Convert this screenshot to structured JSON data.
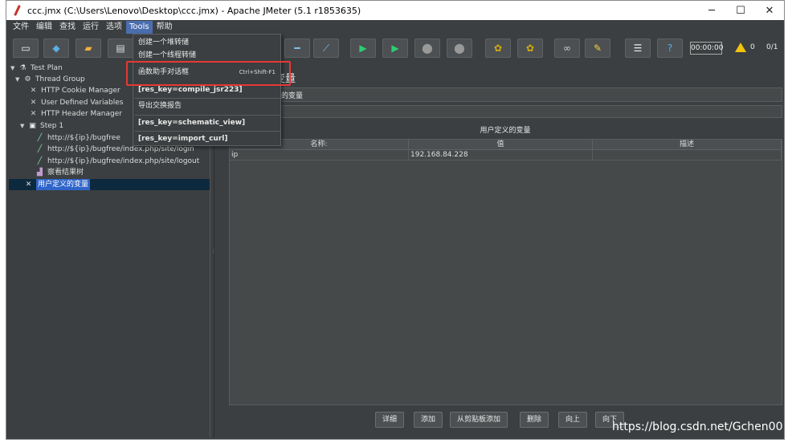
{
  "window": {
    "title": "ccc.jmx (C:\\Users\\Lenovo\\Desktop\\ccc.jmx) - Apache JMeter (5.1 r1853635)"
  },
  "menubar": {
    "items": [
      "文件",
      "编辑",
      "查找",
      "运行",
      "选项",
      "Tools",
      "帮助"
    ],
    "active": "Tools"
  },
  "tools_menu": {
    "items": [
      {
        "label": "创建一个堆转储",
        "shortcut": ""
      },
      {
        "label": "创建一个线程转储",
        "shortcut": ""
      },
      {
        "label": "函数助手对话框",
        "shortcut": "Ctrl+Shift-F1"
      },
      {
        "label": "[res_key=compile_jsr223]",
        "shortcut": ""
      },
      {
        "label": "导出交换报告",
        "shortcut": ""
      },
      {
        "label": "[res_key=schematic_view]",
        "shortcut": ""
      },
      {
        "label": "[res_key=import_curl]",
        "shortcut": ""
      }
    ]
  },
  "toolbar": {
    "timer": "00:00:00",
    "warnings": "0",
    "threads": "0/1"
  },
  "tree": {
    "items": [
      {
        "label": "Test Plan",
        "icon": "test-plan-icon"
      },
      {
        "label": "Thread Group",
        "icon": "gear-icon"
      },
      {
        "label": "HTTP Cookie Manager",
        "icon": "wrench-icon"
      },
      {
        "label": "User Defined Variables",
        "icon": "wrench-icon"
      },
      {
        "label": "HTTP Header Manager",
        "icon": "wrench-icon"
      },
      {
        "label": "Step 1",
        "icon": "controller-icon"
      },
      {
        "label": "http://${ip}/bugfree",
        "icon": "pipette-icon"
      },
      {
        "label": "http://${ip}/bugfree/index.php/site/login",
        "icon": "pipette-icon"
      },
      {
        "label": "http://${ip}/bugfree/index.php/site/logout",
        "icon": "pipette-icon"
      },
      {
        "label": "察看结果树",
        "icon": "chart-icon"
      },
      {
        "label": "用户定义的变量",
        "icon": "wrench-icon"
      }
    ]
  },
  "panel": {
    "title": "变量",
    "name_value": "义的变量",
    "table_title": "用户定义的变量",
    "columns": [
      "名称:",
      "值",
      "描述"
    ],
    "rows": [
      {
        "name": "ip",
        "value": "192.168.84.228",
        "desc": ""
      }
    ]
  },
  "buttons": [
    "详细",
    "添加",
    "从剪贴板添加",
    "删除",
    "向上",
    "向下"
  ],
  "watermark": "https://blog.csdn.net/Gchen00",
  "colors": {
    "background": "#3c3f41",
    "selection": "#2f65ca",
    "highlight": "#e53935"
  }
}
